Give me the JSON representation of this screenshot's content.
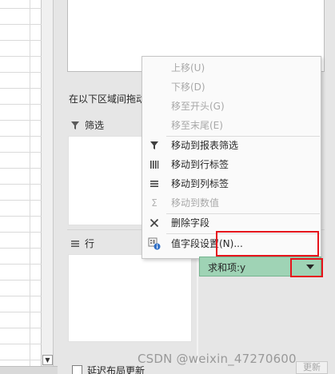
{
  "pane": {
    "drag_hint": "在以下区域间拖动字段:",
    "filters_label": "筛选",
    "rows_label": "行",
    "defer_label": "延迟布局更新",
    "update_label": "更新"
  },
  "context_menu": {
    "items": [
      {
        "label": "上移(U)",
        "enabled": false,
        "icon": ""
      },
      {
        "label": "下移(D)",
        "enabled": false,
        "icon": ""
      },
      {
        "label": "移至开头(G)",
        "enabled": false,
        "icon": ""
      },
      {
        "label": "移至末尾(E)",
        "enabled": false,
        "icon": ""
      },
      {
        "label": "移动到报表筛选",
        "enabled": true,
        "icon": "filter-icon"
      },
      {
        "label": "移动到行标签",
        "enabled": true,
        "icon": "rows-icon"
      },
      {
        "label": "移动到列标签",
        "enabled": true,
        "icon": "columns-icon"
      },
      {
        "label": "移动到数值",
        "enabled": false,
        "icon": "sigma-icon"
      },
      {
        "label": "删除字段",
        "enabled": true,
        "icon": "delete-icon"
      },
      {
        "label": "值字段设置(N)...",
        "enabled": true,
        "icon": "field-settings-icon"
      }
    ]
  },
  "value_field": {
    "label": "求和项:y"
  },
  "watermark": "CSDN @weixin_47270600",
  "colors": {
    "value_chip": "#9fd3b5",
    "annotation": "#e6141c"
  }
}
